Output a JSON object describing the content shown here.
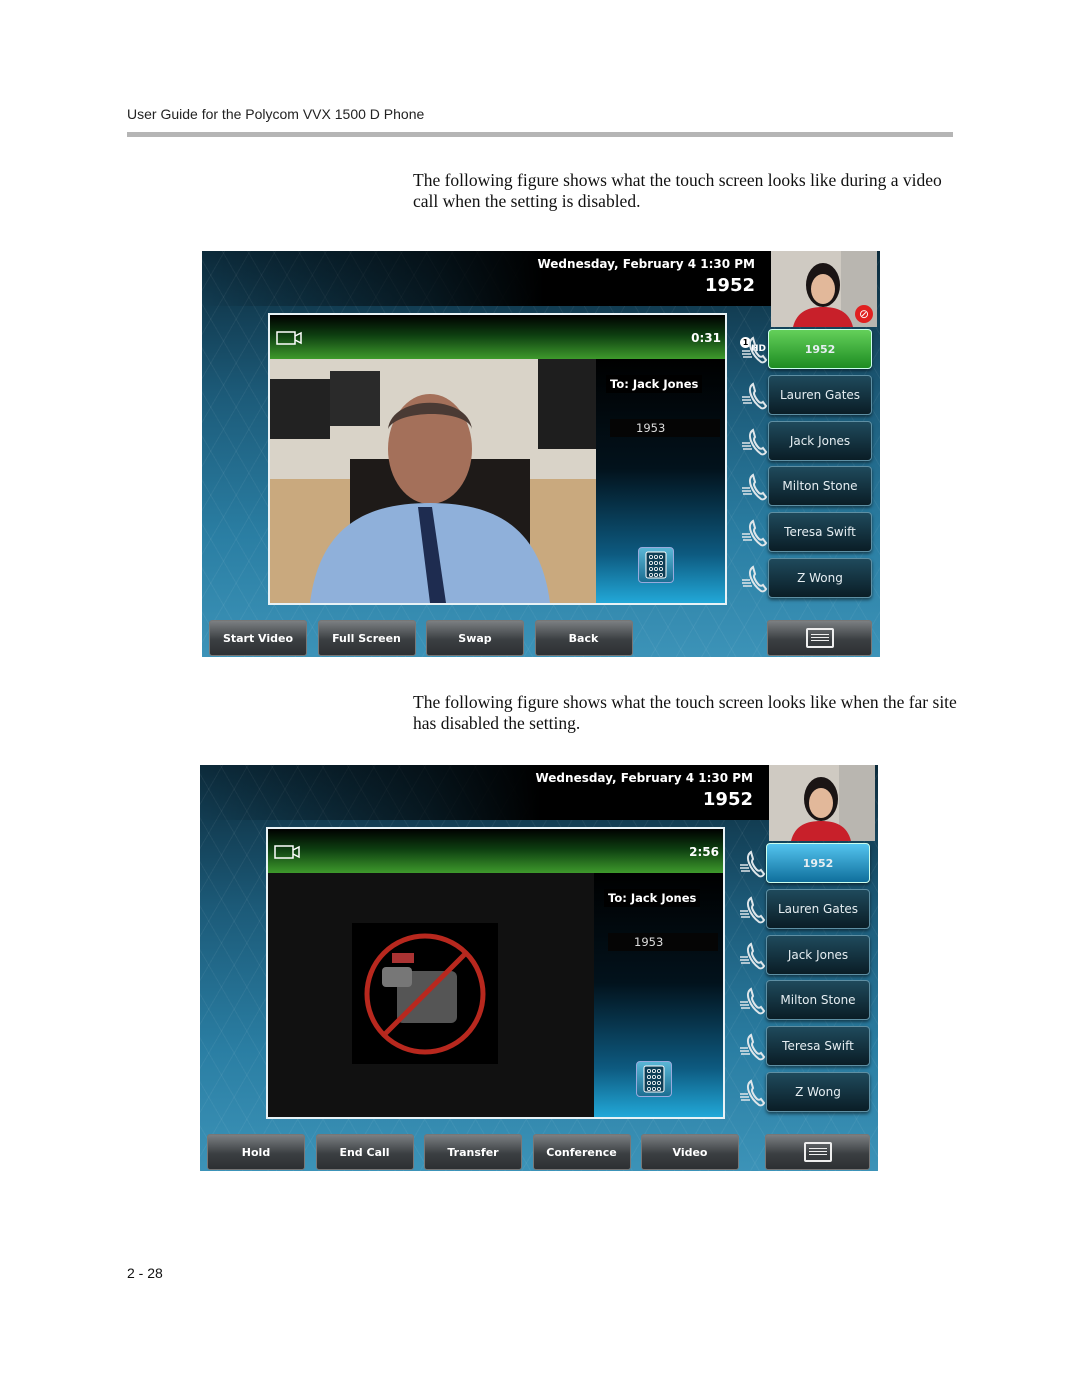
{
  "running_head": "User Guide for the Polycom VVX 1500 D Phone",
  "paragraph_1": "The following figure shows what the touch screen looks like during a video call when the setting is disabled.",
  "paragraph_2": "The following figure shows what the touch screen looks like when the far site has disabled the setting.",
  "page_number": "2 - 28",
  "phones": [
    {
      "date_time": "Wednesday, February 4  1:30 PM",
      "extension": "1952",
      "timer": "0:31",
      "to_label": "To: Jack Jones",
      "call_number": "1953",
      "video_state": "live-video",
      "self_view_muted": true,
      "hd_indicator": "HD",
      "call_count": "1",
      "active_line_color": "#3cb83a",
      "lines": [
        "1952",
        "Lauren Gates",
        "Jack Jones",
        "Milton Stone",
        "Teresa Swift",
        "Z Wong"
      ],
      "softkeys": [
        "Start Video",
        "Full Screen",
        "Swap",
        "Back"
      ],
      "menu_icon": "menu-icon"
    },
    {
      "date_time": "Wednesday, February 4  1:30 PM",
      "extension": "1952",
      "timer": "2:56",
      "to_label": "To: Jack Jones",
      "call_number": "1953",
      "video_state": "video-disabled",
      "self_view_muted": false,
      "active_line_color": "#2aa0d4",
      "lines": [
        "1952",
        "Lauren Gates",
        "Jack Jones",
        "Milton Stone",
        "Teresa Swift",
        "Z Wong"
      ],
      "softkeys": [
        "Hold",
        "End Call",
        "Transfer",
        "Conference",
        "Video"
      ],
      "menu_icon": "menu-icon"
    }
  ]
}
